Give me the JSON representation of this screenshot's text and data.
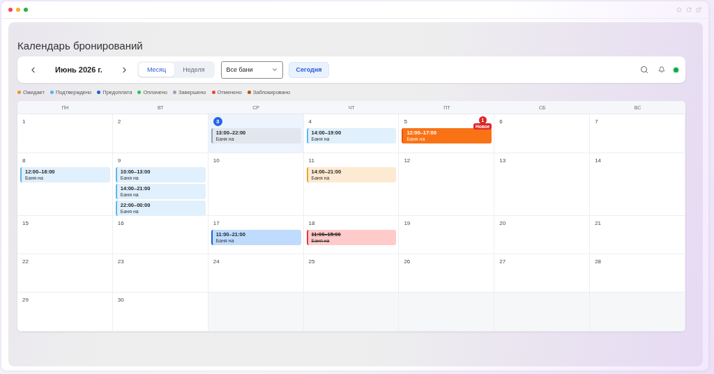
{
  "title": "Календарь бронирований",
  "toolbar": {
    "month_label": "Июнь 2026 г.",
    "views": [
      {
        "label": "Месяц",
        "selected": true
      },
      {
        "label": "Неделя",
        "selected": false
      }
    ],
    "filter": {
      "value": "Все бани"
    },
    "today_button": "Сегодня",
    "online": true
  },
  "legend": [
    {
      "label": "Ожидает",
      "color": "#f0922b"
    },
    {
      "label": "Подтверждено",
      "color": "#4fb3ea"
    },
    {
      "label": "Предоплата",
      "color": "#1d5fd8"
    },
    {
      "label": "Оплачено",
      "color": "#22c55e"
    },
    {
      "label": "Завершено",
      "color": "#94a3b8"
    },
    {
      "label": "Отменено",
      "color": "#ef4444"
    },
    {
      "label": "Заблокировано",
      "color": "#b4530f"
    }
  ],
  "weekdays": [
    "ПН",
    "ВТ",
    "СР",
    "ЧТ",
    "ПТ",
    "СБ",
    "ВС"
  ],
  "weeks": [
    [
      {
        "day": "1",
        "today": false
      },
      {
        "day": "2",
        "today": false
      },
      {
        "day": "3",
        "today": true,
        "events": [
          {
            "time": "13:00–22:00",
            "title": "Баня на",
            "kind": "completed"
          }
        ]
      },
      {
        "day": "4",
        "today": false,
        "events": [
          {
            "time": "14:00–19:00",
            "title": "Баня на",
            "kind": "confirmed"
          }
        ]
      },
      {
        "day": "5",
        "today": false,
        "badge": {
          "count": "1",
          "label": "Новое"
        },
        "events": [
          {
            "time": "12:00–17:00",
            "title": "Баня на",
            "kind": "new"
          }
        ]
      },
      {
        "day": "6",
        "today": false
      },
      {
        "day": "7",
        "today": false
      }
    ],
    [
      {
        "day": "8",
        "today": false,
        "events": [
          {
            "time": "12:00–16:00",
            "title": "Баня на",
            "kind": "confirmed"
          }
        ]
      },
      {
        "day": "9",
        "today": false,
        "events": [
          {
            "time": "10:00–13:00",
            "title": "Баня на",
            "kind": "confirmed"
          },
          {
            "time": "14:00–21:00",
            "title": "Баня на",
            "kind": "confirmed"
          },
          {
            "time": "22:00–00:00",
            "title": "Баня на",
            "kind": "confirmed"
          }
        ]
      },
      {
        "day": "10",
        "today": false
      },
      {
        "day": "11",
        "today": false,
        "events": [
          {
            "time": "14:00–21:00",
            "title": "Баня на",
            "kind": "pending"
          }
        ]
      },
      {
        "day": "12",
        "today": false
      },
      {
        "day": "13",
        "today": false
      },
      {
        "day": "14",
        "today": false
      }
    ],
    [
      {
        "day": "15",
        "today": false
      },
      {
        "day": "16",
        "today": false
      },
      {
        "day": "17",
        "today": false,
        "events": [
          {
            "time": "11:00–21:00",
            "title": "Баня на",
            "kind": "prepaid"
          }
        ]
      },
      {
        "day": "18",
        "today": false,
        "events": [
          {
            "time": "11:00–15:00",
            "title": "Баня на",
            "kind": "cancelled"
          }
        ]
      },
      {
        "day": "19",
        "today": false
      },
      {
        "day": "20",
        "today": false
      },
      {
        "day": "21",
        "today": false
      }
    ],
    [
      {
        "day": "22",
        "today": false
      },
      {
        "day": "23",
        "today": false
      },
      {
        "day": "24",
        "today": false
      },
      {
        "day": "25",
        "today": false
      },
      {
        "day": "26",
        "today": false
      },
      {
        "day": "27",
        "today": false
      },
      {
        "day": "28",
        "today": false
      }
    ],
    [
      {
        "day": "29",
        "today": false
      },
      {
        "day": "30",
        "today": false
      },
      {
        "kind": "blank"
      },
      {
        "kind": "blank"
      },
      {
        "kind": "blank"
      },
      {
        "kind": "blank"
      },
      {
        "kind": "blank"
      }
    ]
  ]
}
